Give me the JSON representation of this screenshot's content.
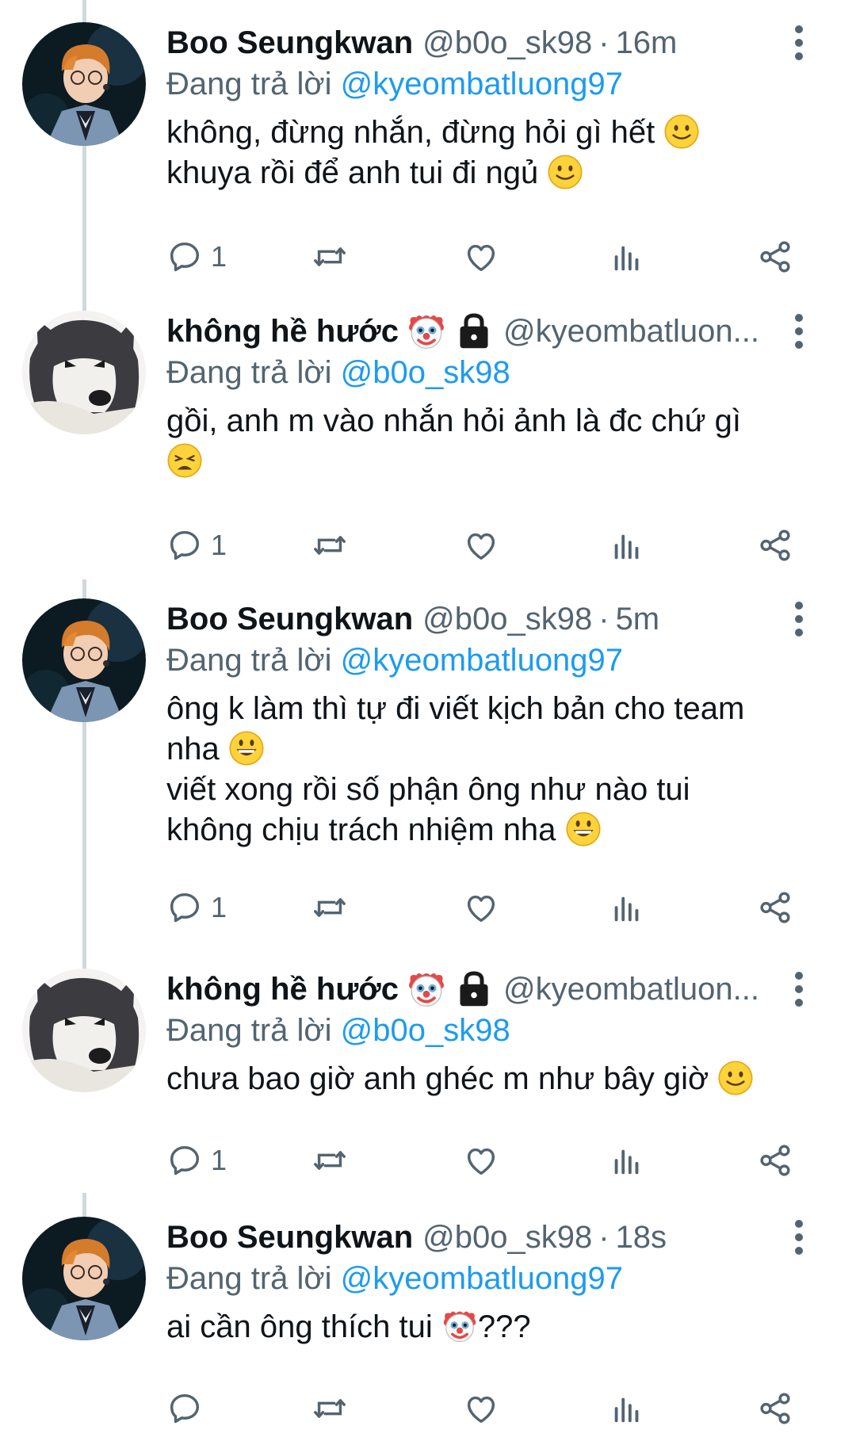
{
  "tweets": [
    {
      "name": "Boo Seungkwan",
      "handle": "@b0o_sk98",
      "time": "16m",
      "reply_label": "Đang trả lời ",
      "reply_to": "@kyeombatluong97",
      "lines": [
        "không, đừng nhắn, đừng hỏi gì hết",
        "khuya rồi để anh tui đi ngủ"
      ],
      "reply_count": "1",
      "avatar": "boy-avatar"
    },
    {
      "name": "không hề hước",
      "handle": "@kyeombatluon...",
      "reply_label": "Đang trả lời ",
      "reply_to": "@b0o_sk98",
      "lines": [
        "gồi, anh m vào nhắn hỏi ảnh là đc chứ gì"
      ],
      "reply_count": "1",
      "avatar": "husky-avatar"
    },
    {
      "name": "Boo Seungkwan",
      "handle": "@b0o_sk98",
      "time": "5m",
      "reply_label": "Đang trả lời ",
      "reply_to": "@kyeombatluong97",
      "lines": [
        "ông k làm thì tự đi viết kịch bản cho team",
        "nha",
        "viết xong rồi số phận ông như nào tui",
        "không chịu trách nhiệm nha"
      ],
      "reply_count": "1",
      "avatar": "boy-avatar"
    },
    {
      "name": "không hề hước",
      "handle": "@kyeombatluon...",
      "reply_label": "Đang trả lời ",
      "reply_to": "@b0o_sk98",
      "lines": [
        "chưa bao giờ anh ghéc m như bây giờ"
      ],
      "reply_count": "1",
      "avatar": "husky-avatar"
    },
    {
      "name": "Boo Seungkwan",
      "handle": "@b0o_sk98",
      "time": "18s",
      "reply_label": "Đang trả lời ",
      "reply_to": "@kyeombatluong97",
      "lines": [
        "ai cần ông thích tui",
        "???"
      ],
      "reply_count": "",
      "avatar": "boy-avatar"
    }
  ],
  "dot_separator": "·",
  "colors": {
    "link": "#1d9bf0",
    "secondary": "#536471",
    "text": "#0f1419",
    "line": "#cfd9de"
  }
}
